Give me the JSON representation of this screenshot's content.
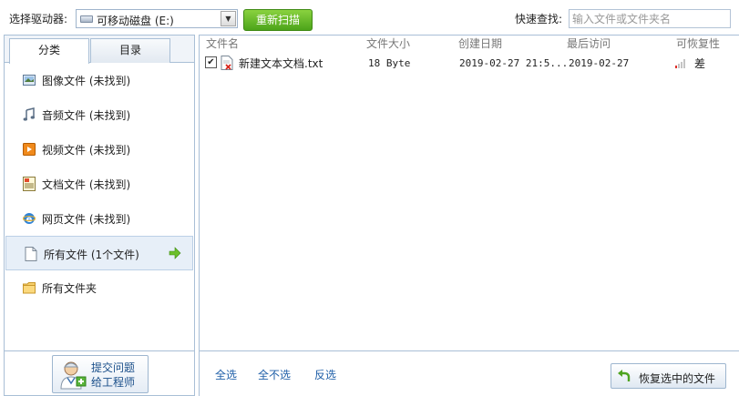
{
  "toolbar": {
    "drive_label": "选择驱动器:",
    "drive_value": "可移动磁盘 (E:)",
    "rescan_label": "重新扫描",
    "quick_search_label": "快速查找:",
    "search_placeholder": "输入文件或文件夹名"
  },
  "tabs": [
    {
      "label": "分类",
      "active": true
    },
    {
      "label": "目录",
      "active": false
    }
  ],
  "categories": [
    {
      "label": "图像文件 (未找到)",
      "icon": "image-icon"
    },
    {
      "label": "音频文件 (未找到)",
      "icon": "music-icon"
    },
    {
      "label": "视频文件 (未找到)",
      "icon": "video-icon"
    },
    {
      "label": "文档文件 (未找到)",
      "icon": "document-icon"
    },
    {
      "label": "网页文件 (未找到)",
      "icon": "ie-icon"
    },
    {
      "label": "所有文件 (1个文件)",
      "icon": "blank-file-icon",
      "selected": true
    },
    {
      "label": "所有文件夹",
      "icon": "folder-icon"
    }
  ],
  "engineer_button": {
    "line1": "提交问题",
    "line2": "给工程师"
  },
  "columns": [
    "文件名",
    "文件大小",
    "创建日期",
    "最后访问",
    "可恢复性"
  ],
  "files": [
    {
      "checked": true,
      "name": "新建文本文档.txt",
      "size": "18 Byte",
      "created": "2019-02-27 21:5...",
      "accessed": "2019-02-27",
      "recoverability": "差"
    }
  ],
  "bottom": {
    "select_all": "全选",
    "select_none": "全不选",
    "invert": "反选",
    "restore_label": "恢复选中的文件"
  },
  "colors": {
    "accent_green": "#5cb82a",
    "border_blue": "#a9bfd6",
    "link_blue": "#1f5fa8"
  }
}
